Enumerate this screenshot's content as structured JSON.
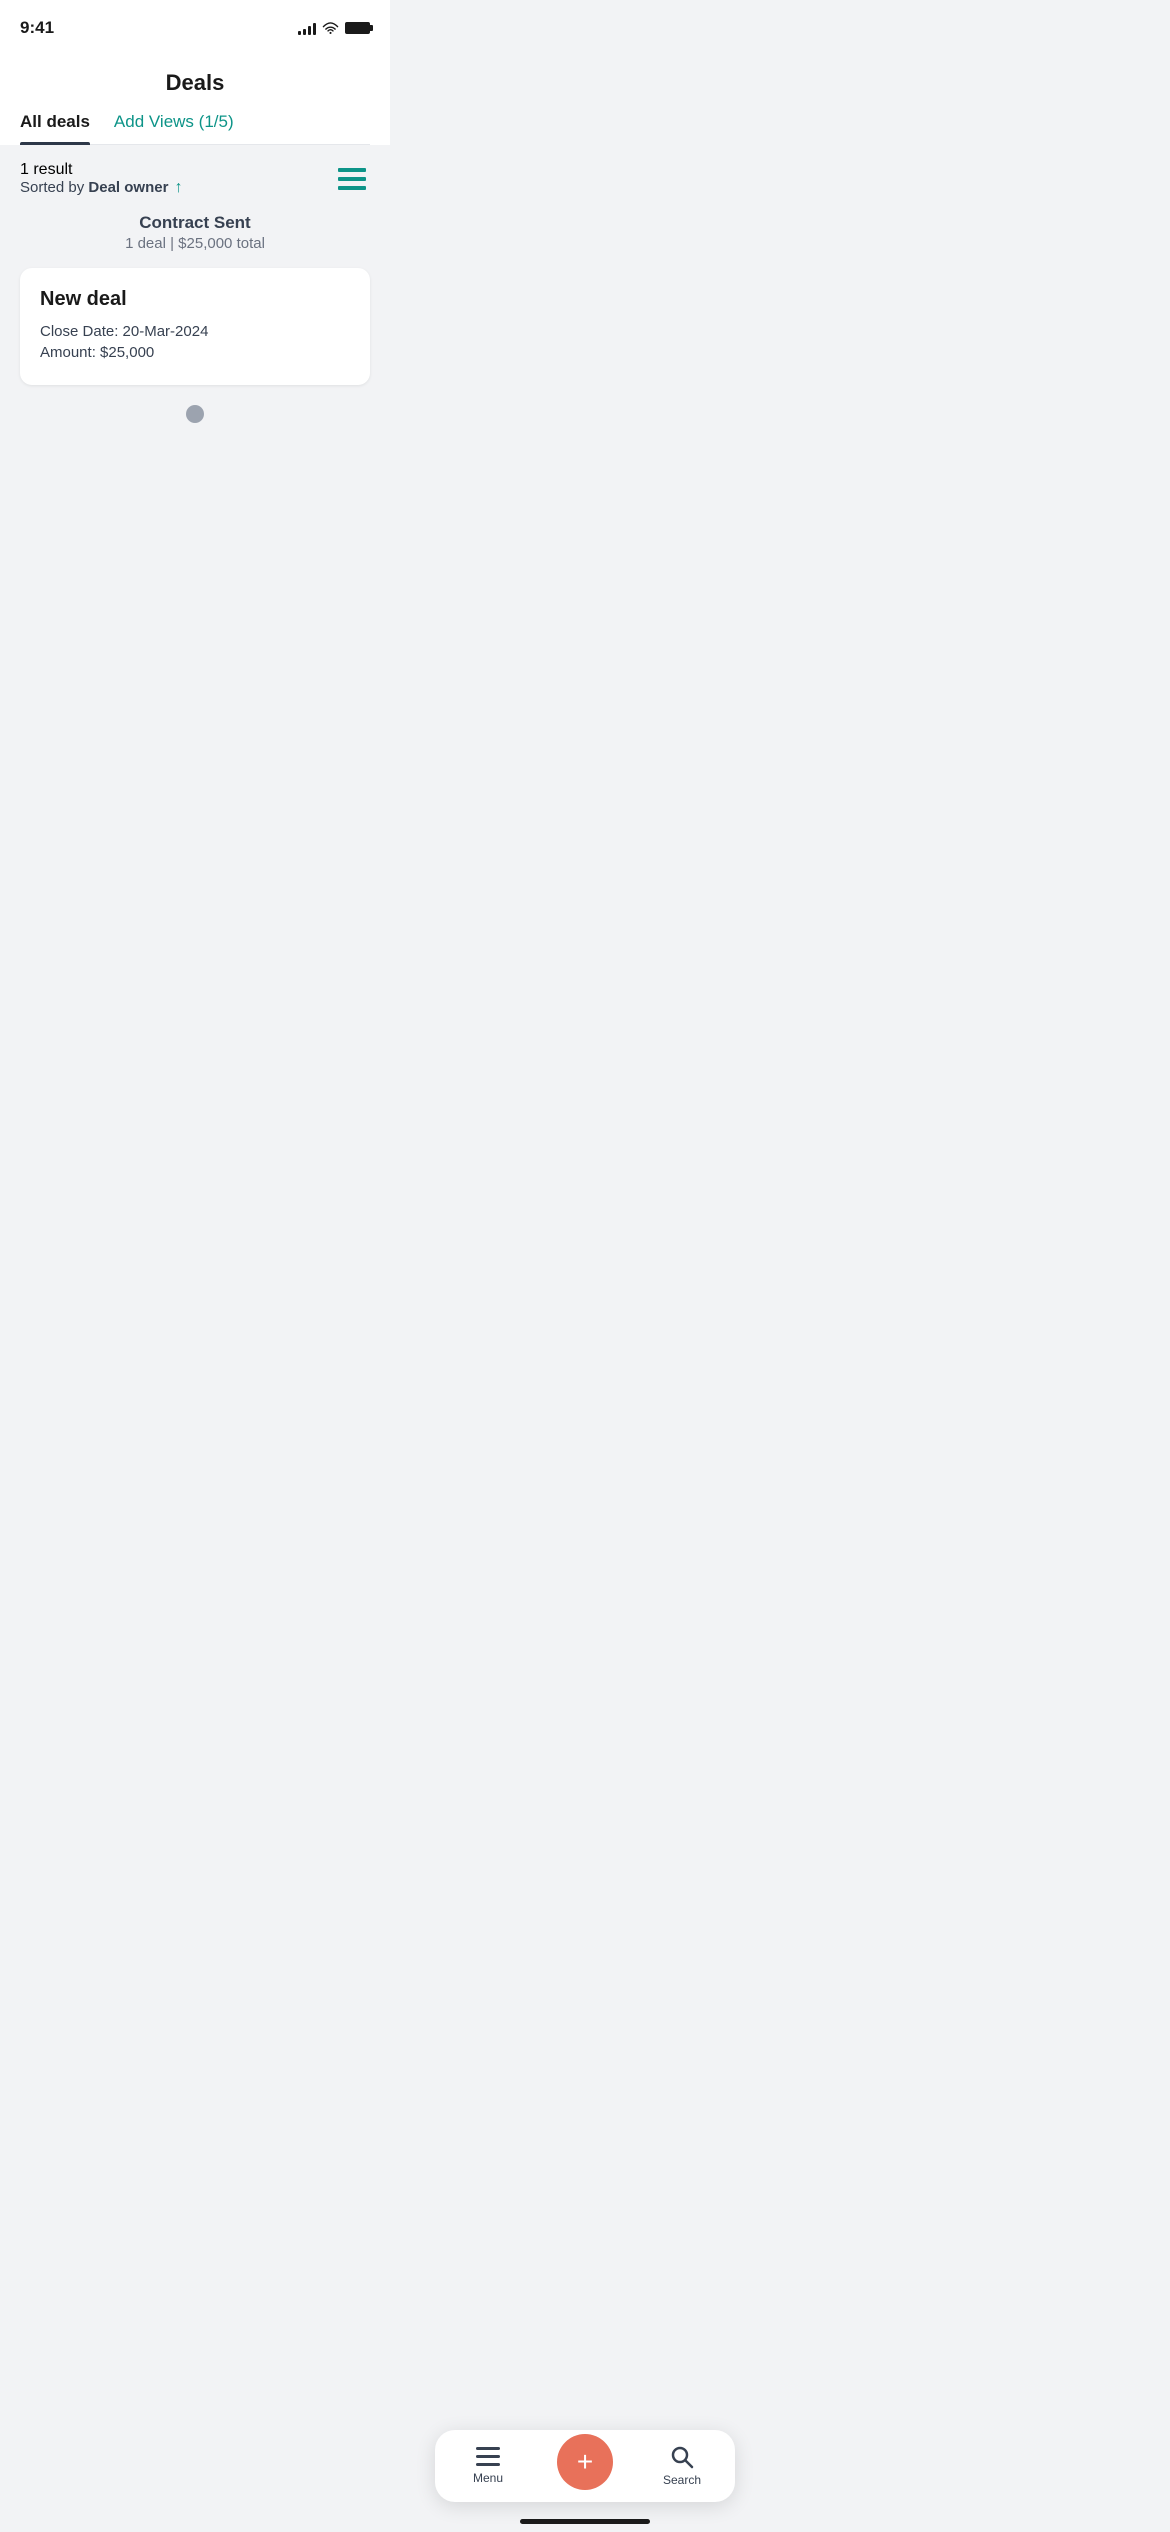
{
  "statusBar": {
    "time": "9:41",
    "signalBars": [
      4,
      6,
      8,
      11,
      13
    ],
    "batteryFull": true
  },
  "header": {
    "title": "Deals",
    "tabs": [
      {
        "id": "all-deals",
        "label": "All deals",
        "active": true
      },
      {
        "id": "add-views",
        "label": "Add Views (1/5)",
        "active": false
      }
    ]
  },
  "results": {
    "count": "1 result",
    "sortedByLabel": "Sorted by",
    "sortField": "Deal owner",
    "sortDirection": "asc"
  },
  "stage": {
    "name": "Contract Sent",
    "dealCount": "1 deal",
    "total": "$25,000 total",
    "summary": "1 deal | $25,000 total"
  },
  "deal": {
    "name": "New deal",
    "closeDate": "Close Date: 20-Mar-2024",
    "amount": "Amount: $25,000"
  },
  "bottomNav": {
    "menu": {
      "label": "Menu"
    },
    "add": {
      "label": "Add"
    },
    "search": {
      "label": "Search"
    }
  }
}
